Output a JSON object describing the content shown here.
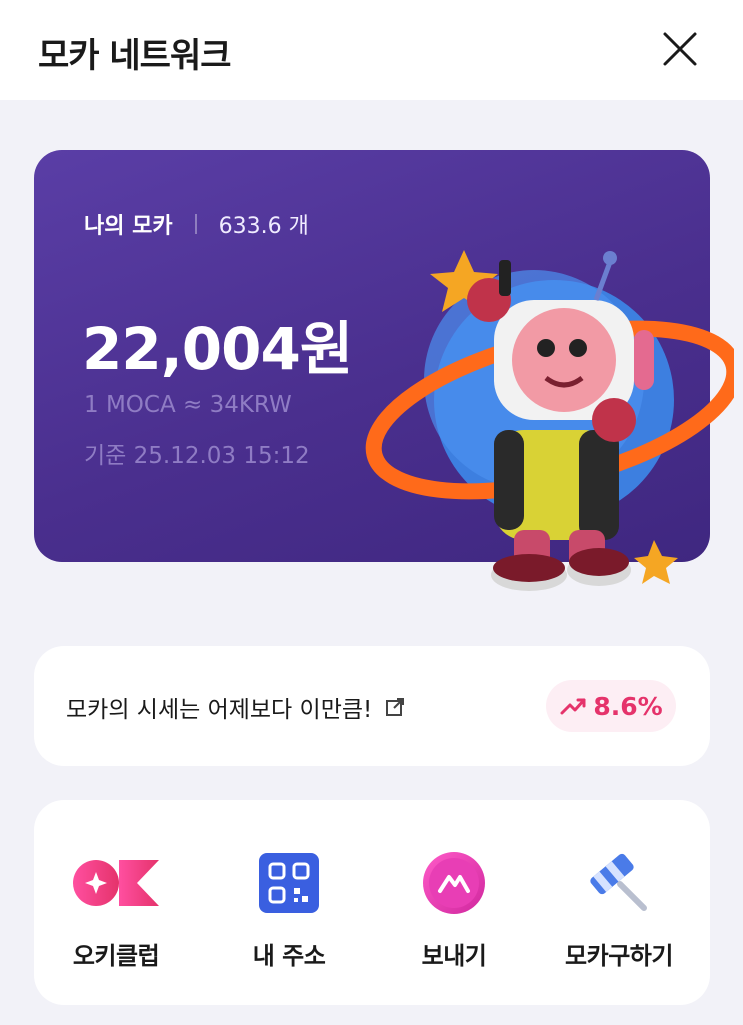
{
  "header": {
    "title": "모카 네트워크"
  },
  "balance": {
    "label": "나의 모카",
    "count": "633.6 개",
    "amount": "22,004원",
    "rate": "1 MOCA ≈ 34KRW",
    "time": "기준 25.12.03 15:12"
  },
  "price": {
    "text": "모카의 시세는 어제보다 이만큼!",
    "change": "8.6%"
  },
  "menu": {
    "items": [
      {
        "label": "오키클럽",
        "icon": "ok-club-icon"
      },
      {
        "label": "내 주소",
        "icon": "qr-code-icon"
      },
      {
        "label": "보내기",
        "icon": "send-moca-icon"
      },
      {
        "label": "모카구하기",
        "icon": "hammer-icon"
      }
    ]
  },
  "colors": {
    "card_bg": "#4a2f8e",
    "accent_pink": "#e5336b",
    "badge_bg": "#fdeef4"
  }
}
